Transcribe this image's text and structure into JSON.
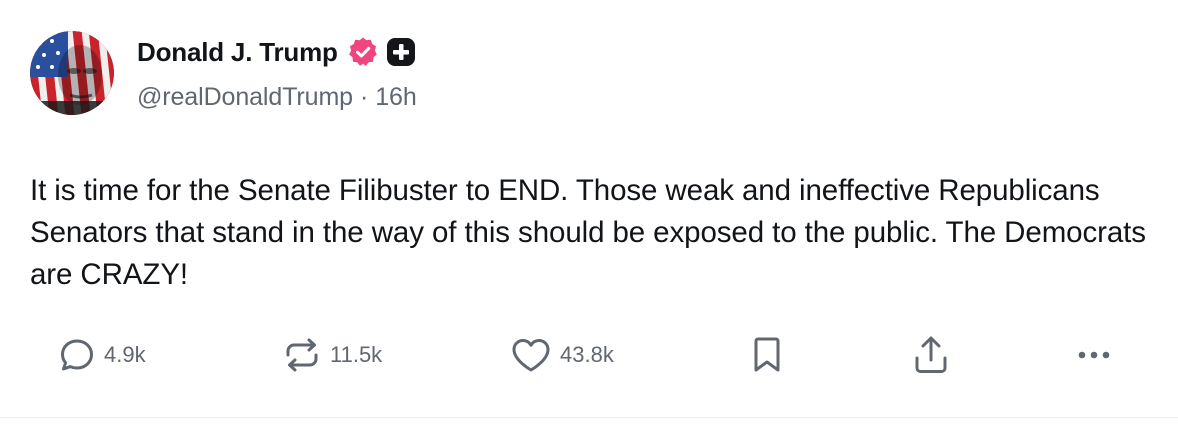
{
  "author": {
    "display_name": "Donald J. Trump",
    "handle": "@realDonaldTrump",
    "separator": "·",
    "time_ago": "16h",
    "verified_icon": "verified-badge-icon",
    "plus_icon": "plus-badge-icon",
    "verified_color": "#f0457e"
  },
  "post": {
    "text": "It is time for the Senate Filibuster to END. Those weak and ineffective Republicans Senators that stand in the way of this should be exposed to the public. The Democrats are CRAZY!"
  },
  "actions": {
    "replies": {
      "icon": "reply-icon",
      "count": "4.9k"
    },
    "retruths": {
      "icon": "retruth-icon",
      "count": "11.5k"
    },
    "likes": {
      "icon": "heart-icon",
      "count": "43.8k"
    },
    "bookmark": {
      "icon": "bookmark-icon"
    },
    "share": {
      "icon": "share-icon"
    },
    "more": {
      "icon": "more-icon"
    }
  }
}
